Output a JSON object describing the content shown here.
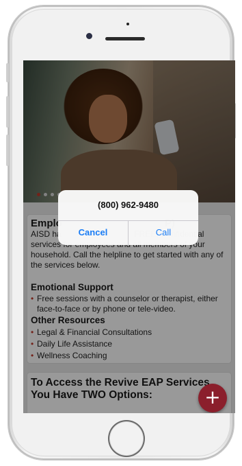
{
  "dialog": {
    "title": "(800) 962-9480",
    "cancel_label": "Cancel",
    "call_label": "Call"
  },
  "carousel": {
    "dots": 4,
    "active_index": 0
  },
  "card1": {
    "title": "Emplo                                    P)",
    "body": "AISD ha                                FREE, Confidential services for employees and all members of your household. Call the helpline to get started with any of the services below.",
    "section1_title": "Emotional Support",
    "section1_items": [
      "Free sessions with a counselor or therapist, either face-to-face or by phone or tele-video."
    ],
    "section2_title": "Other Resources",
    "section2_items": [
      "Legal & Financial Consultations",
      "Daily Life Assistance",
      "Wellness Coaching"
    ]
  },
  "card2": {
    "title": "To Access the Revive EAP Services, You Have TWO Options:"
  },
  "fab": {
    "icon": "plus-icon",
    "glyph": "+"
  },
  "colors": {
    "accent": "#c0392b",
    "fab": "#8b1f2c",
    "dialog_button": "#1a7df5"
  }
}
